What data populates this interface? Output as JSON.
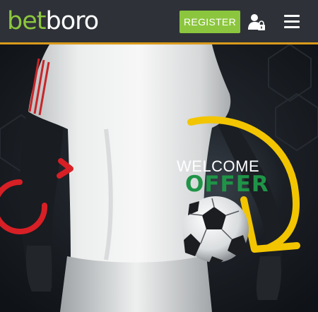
{
  "header": {
    "logo_primary": "bet",
    "logo_secondary": "boro",
    "register_label": "REGISTER",
    "user_icon": "user-lock-icon",
    "menu_icon": "hamburger-menu-icon"
  },
  "hero": {
    "welcome_text": "WELCOME",
    "offer_text": "OFFER"
  },
  "colors": {
    "brand_green": "#8cc63e",
    "offer_green": "#1f9447",
    "header_bg": "#2e3238",
    "accent_orange": "#d99a1b",
    "arrow_red": "#d71f26",
    "arrow_yellow": "#f2c500"
  }
}
